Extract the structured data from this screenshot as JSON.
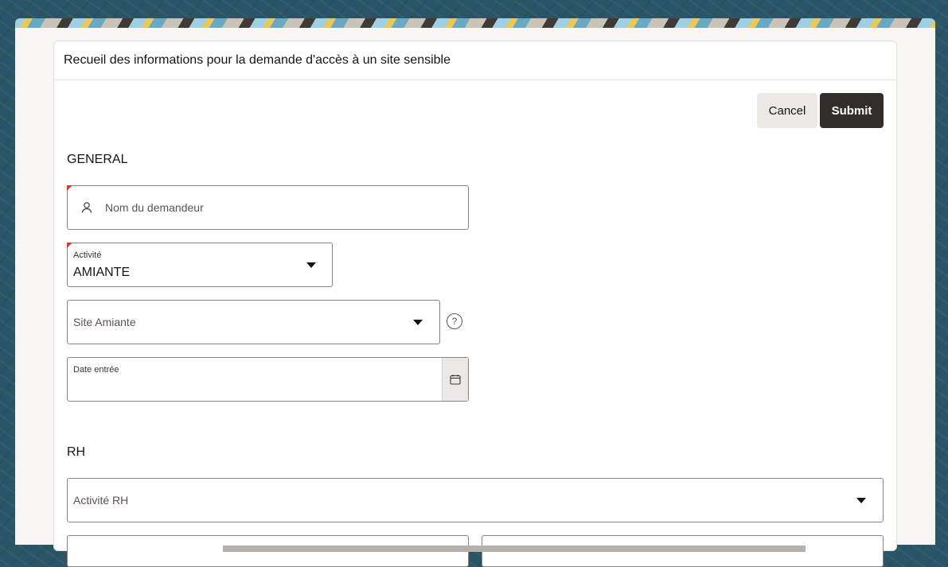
{
  "form": {
    "title": "Recueil des informations pour la demande d'accès à un site sensible",
    "actions": {
      "cancel": "Cancel",
      "submit": "Submit"
    },
    "general": {
      "section_title": "GENERAL",
      "nom_demandeur": {
        "placeholder": "Nom du demandeur",
        "icon": "user-icon",
        "required": true
      },
      "activite": {
        "label": "Activité",
        "value": "AMIANTE",
        "required": true
      },
      "site_amiante": {
        "placeholder": "Site Amiante",
        "help_icon": "help-icon",
        "help_text": "?"
      },
      "date_entree": {
        "label": "Date entrée",
        "value": "",
        "icon": "calendar-icon"
      }
    },
    "rh": {
      "section_title": "RH",
      "activite_rh": {
        "placeholder": "Activité RH"
      }
    }
  },
  "colors": {
    "primary_button": "#312d2a",
    "required_marker": "#d63b25",
    "background": "#2b5567"
  }
}
